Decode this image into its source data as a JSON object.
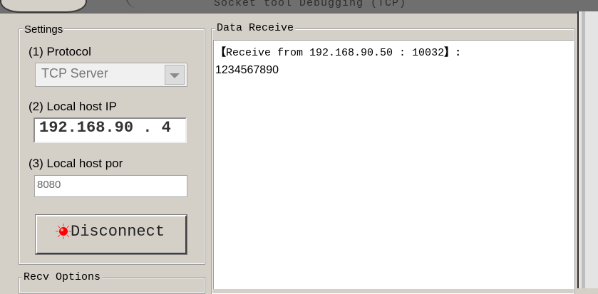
{
  "window": {
    "title": "Socket tool Debugging (TCP)"
  },
  "settings": {
    "legend": "Settings",
    "protocol_label": "(1) Protocol",
    "protocol_value": "TCP Server",
    "local_ip_label": "(2) Local host IP",
    "local_ip": "192.168.90 . 4",
    "local_port_label": "(3) Local host por",
    "local_port": "8080",
    "disconnect_label": "Disconnect"
  },
  "recv_options": {
    "legend": "Recv Options"
  },
  "data_receive": {
    "legend": "Data Receive",
    "line1_open": "【",
    "line1_text": "Receive from 192.168.90.50 : 10032",
    "line1_close": "】:",
    "line2": "1234567890"
  },
  "icons": {
    "status_led": "red-led-icon",
    "combo_arrow": "chevron-down-icon"
  },
  "colors": {
    "panel": "#d4d0c8",
    "led": "#ff0000"
  }
}
